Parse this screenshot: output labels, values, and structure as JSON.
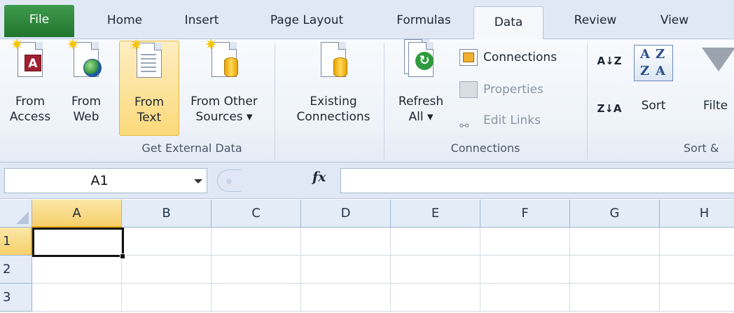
{
  "tabs": {
    "file": "File",
    "home": "Home",
    "insert": "Insert",
    "page_layout": "Page Layout",
    "formulas": "Formulas",
    "data": "Data",
    "review": "Review",
    "view": "View"
  },
  "ribbon": {
    "get_external_data": {
      "label": "Get External Data",
      "from_access": [
        "From",
        "Access"
      ],
      "from_web": [
        "From",
        "Web"
      ],
      "from_text": [
        "From",
        "Text"
      ],
      "from_other_sources": [
        "From Other",
        "Sources ▾"
      ],
      "existing_connections": [
        "Existing",
        "Connections"
      ]
    },
    "connections": {
      "label": "Connections",
      "refresh_all": [
        "Refresh",
        "All ▾"
      ],
      "connections": "Connections",
      "properties": "Properties",
      "edit_links": "Edit Links"
    },
    "sort_filter": {
      "label": "Sort &",
      "sort_az": "A↓Z",
      "sort_za": "Z↓A",
      "sort": "Sort",
      "filter": "Filte"
    }
  },
  "formula_bar": {
    "name_box": "A1",
    "fx": "fx",
    "formula": ""
  },
  "grid": {
    "columns": [
      "A",
      "B",
      "C",
      "D",
      "E",
      "F",
      "G",
      "H"
    ],
    "rows": [
      "1",
      "2",
      "3"
    ],
    "selected_cell": "A1"
  },
  "colors": {
    "file_tab": "#22762f",
    "selection_header": "#f6cf6a",
    "pressed_button": "#fbd97a"
  }
}
